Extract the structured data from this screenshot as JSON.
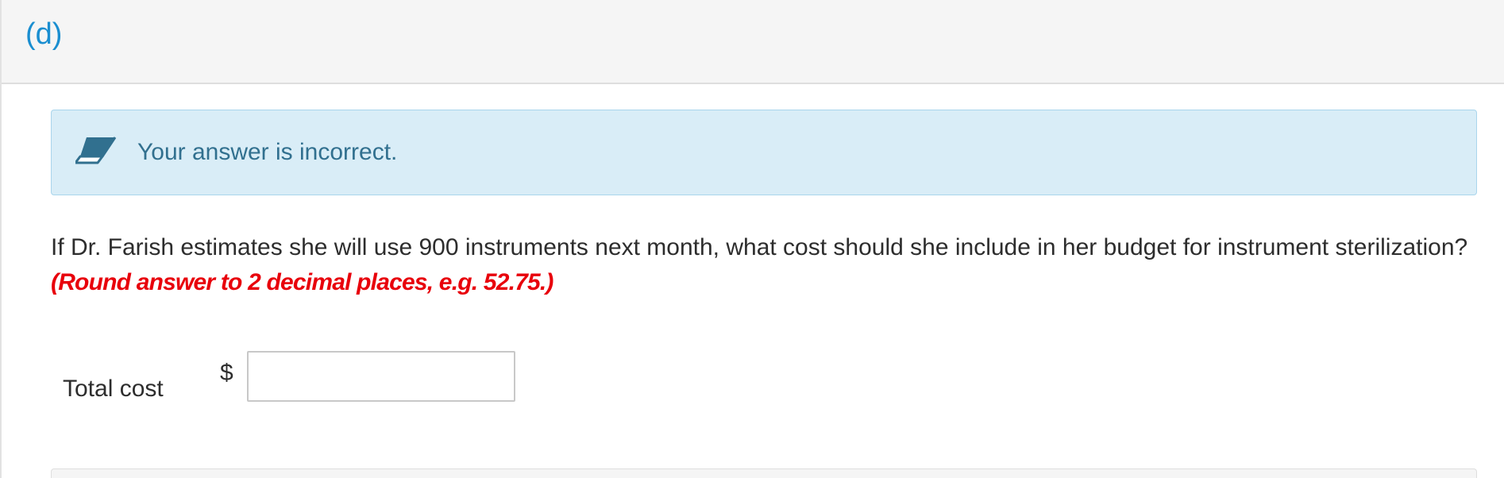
{
  "part": {
    "label": "(d)"
  },
  "feedback": {
    "icon": "eraser-icon",
    "message": "Your answer is incorrect.",
    "colors": {
      "background": "#d9edf7",
      "border": "#a9d5ec",
      "text": "#31708f"
    }
  },
  "question": {
    "text": "If Dr. Farish estimates she will use 900 instruments next month, what cost should she include in her budget for instrument sterilization?",
    "rounding_note": "(Round answer to 2 decimal places, e.g. 52.75.)"
  },
  "answer": {
    "label": "Total cost",
    "currency_symbol": "$",
    "value": ""
  },
  "colors": {
    "part_label": "#1a8ed0",
    "rounding_note": "#e8000b"
  }
}
